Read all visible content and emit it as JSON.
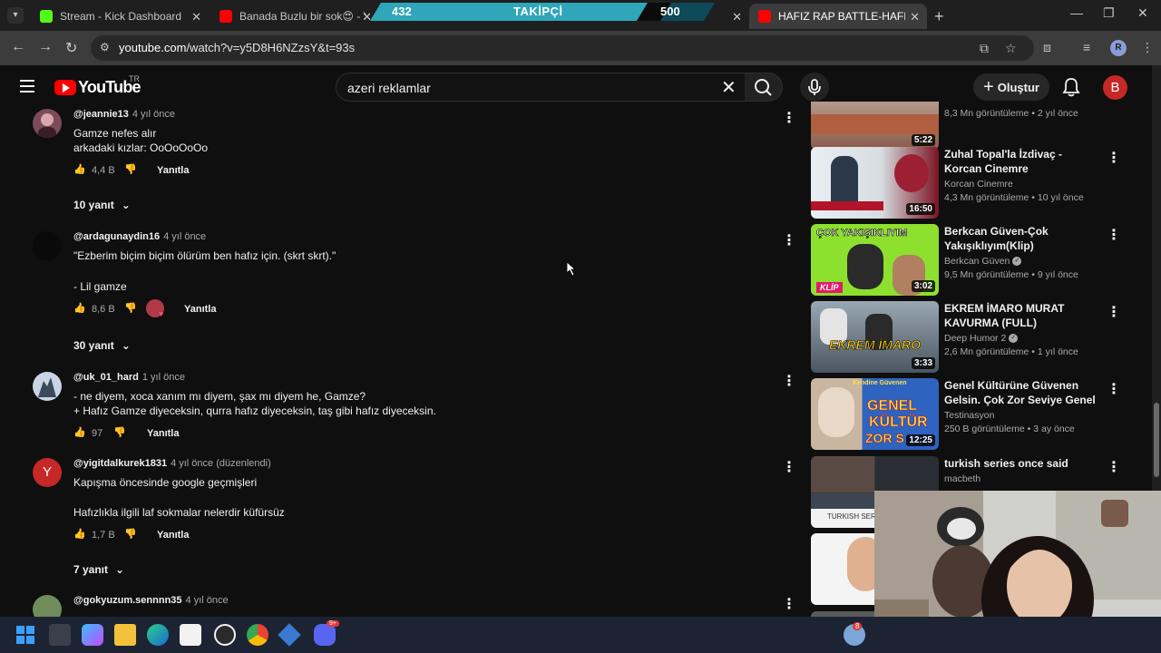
{
  "browser": {
    "tabs": [
      {
        "title": "Stream - Kick Dashboard",
        "favicon_color": "#53fc18",
        "active": false
      },
      {
        "title": "Banada Buzlu bir sok😍 - YouTu",
        "favicon_color": "#ff0000",
        "active": false
      },
      {
        "title": "",
        "favicon_color": "#ff0000",
        "active": false
      },
      {
        "title": "HAFIZ RAP BATTLE-HAFIZLAR K",
        "favicon_color": "#ff0000",
        "active": true
      }
    ],
    "url_host": "youtube.com",
    "url_path": "/watch?v=y5D8H6NZzsY&t=93s",
    "profile_initial": "R"
  },
  "follower_goal": {
    "current": "432",
    "label": "TAKİPÇİ",
    "goal": "500",
    "progress": 0.864
  },
  "youtube": {
    "logo_text": "YouTube",
    "country": "TR",
    "search_value": "azeri reklamlar",
    "create_label": "Oluştur",
    "avatar_initial": "B",
    "reply_label": "Yanıtla",
    "comments": [
      {
        "author": "@jeannie13",
        "time": "4 yıl önce",
        "lines": [
          "Gamze nefes alır",
          "arkadaki kızlar: OoOoOoOo"
        ],
        "likes": "4,4 B",
        "replies": "10 yanıt",
        "avatar_color": "#7a4b5a"
      },
      {
        "author": "@ardagunaydin16",
        "time": "4 yıl önce",
        "lines": [
          "\"Ezberim biçim biçim ölürüm ben hafız için. (skrt skrt).\"",
          "",
          "- Lil gamze"
        ],
        "likes": "8,6 B",
        "replies": "30 yanıt",
        "avatar_color": "#0a0a0a"
      },
      {
        "author": "@uk_01_hard",
        "time": "1 yıl önce",
        "lines": [
          "- ne diyem, xoca xanım mı diyem, şax mı diyem he, Gamze?",
          "+ Hafız Gamze diyeceksin, qurra hafız diyeceksin, taş gibi hafız diyeceksin."
        ],
        "likes": "97",
        "replies": "",
        "avatar_color": "#c9d4e6"
      },
      {
        "author": "@yigitdalkurek1831",
        "time": "4 yıl önce (düzenlendi)",
        "lines": [
          "Kapışma öncesinde google geçmişleri",
          "",
          "Hafızlıkla ilgili laf sokmalar nelerdir küfürsüz"
        ],
        "likes": "1,7 B",
        "replies": "7 yanıt",
        "avatar_color": "#c62828",
        "avatar_letter": "Y"
      },
      {
        "author": "@gokyuzum.sennnn35",
        "time": "4 yıl önce",
        "lines": [],
        "likes": "",
        "replies": "",
        "avatar_color": "#6f8c5a"
      }
    ],
    "recommendations": [
      {
        "title": "",
        "channel": "",
        "meta": "8,3 Mn görüntüleme • 2 yıl önce",
        "duration": "5:22",
        "thumb_color": "#8a5a4a"
      },
      {
        "title": "Zuhal Topal'la İzdivaç - Korcan Cinemre",
        "channel": "Korcan Cinemre",
        "meta": "4,3 Mn görüntüleme • 10 yıl önce",
        "duration": "16:50",
        "thumb_color": "#7a2a3a"
      },
      {
        "title": "Berkcan Güven-Çok Yakışıklıyım(Klip)",
        "channel": "Berkcan Güven",
        "meta": "9,5 Mn görüntüleme • 9 yıl önce",
        "duration": "3:02",
        "thumb_color": "#7fd12c",
        "verified": true
      },
      {
        "title": "EKREM İMARO MURAT KAVURMA (FULL)",
        "channel": "Deep Humor 2",
        "meta": "2,6 Mn görüntüleme • 1 yıl önce",
        "duration": "3:33",
        "thumb_color": "#5a6a7a",
        "verified": true
      },
      {
        "title": "Genel Kültürüne Güvenen Gelsin. Çok Zor Seviye Genel ...",
        "channel": "Testinasyon",
        "meta": "250 B görüntüleme • 3 ay önce",
        "duration": "12:25",
        "thumb_color": "#3a6ab0"
      },
      {
        "title": "turkish series once said",
        "channel": "macbeth",
        "meta": "",
        "duration": "",
        "thumb_color": "#3a3a3a"
      }
    ],
    "thumb_texts": {
      "klip": "KLİP",
      "cok": "ÇOK YAKIŞIKLIYIM",
      "ekrem": "EKREM İMARO",
      "genel": "GENEL",
      "kultur": "KÜLTÜR",
      "zor": "ZOR S",
      "kendine": "Kendine Güvenen",
      "turkish": "TURKISH SER"
    }
  },
  "taskbar": {
    "notification_count": "8",
    "discord_badge": "9+"
  }
}
